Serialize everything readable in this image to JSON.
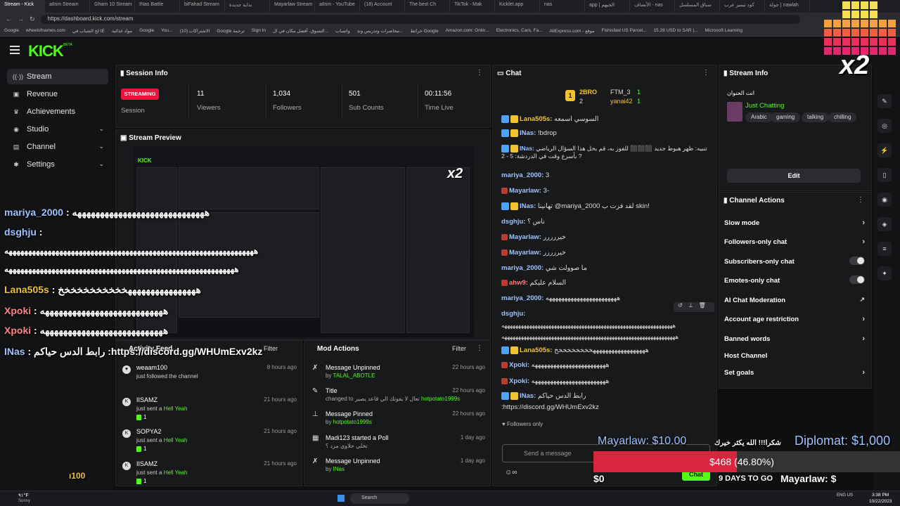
{
  "browser": {
    "tabs": [
      "Stream - Kick",
      "a8sm Stream",
      "Gharn 10 Stream",
      "INas Battle",
      "biFahad Stream",
      "بداية جديدة",
      "Mayarlaw Stream",
      "a8sm - YouTube",
      "(18) Account",
      "The best Ch",
      "TikTok - Mak",
      "Kicklet.app",
      "nas",
      "app | الجيهم",
      "الأنصاف - nas",
      "سباق المسلسل",
      "كود تيميز عرب",
      "جولة | nawlah"
    ],
    "url": "https://dashboard.kick.com/stream",
    "bookmarks": [
      "Google",
      "wheelofnames.com",
      "لج الشباب في IE",
      "مواد غذائية",
      "Google",
      "You...",
      "(10) الاشتراكات",
      "Google ترجمة",
      "Sign In",
      "التسوق، أفضل مكان في ال...",
      "واتساب",
      "محاضرات وتدريس وند...",
      "خرائط Google",
      "Amazon.com: Onlin...",
      "Electronics, Cars, Fa...",
      "AliExpress.com - موقع",
      "Fishisfast US Parcel...",
      "15.28 USD to SAR |...",
      "Microsoft Learning"
    ]
  },
  "header": {
    "logo": "KICK",
    "logo_sup": "BETA"
  },
  "sidebar": {
    "items": [
      {
        "label": "Stream",
        "icon": "stream-icon"
      },
      {
        "label": "Revenue",
        "icon": "revenue-icon"
      },
      {
        "label": "Achievements",
        "icon": "trophy-icon"
      },
      {
        "label": "Studio",
        "icon": "studio-icon"
      },
      {
        "label": "Channel",
        "icon": "channel-icon"
      },
      {
        "label": "Settings",
        "icon": "gear-icon"
      }
    ]
  },
  "session": {
    "title": "Session Info",
    "status": "STREAMING",
    "status_label": "Session",
    "stats": [
      {
        "value": "11",
        "label": "Viewers"
      },
      {
        "value": "1,034",
        "label": "Followers"
      },
      {
        "value": "501",
        "label": "Sub Counts"
      },
      {
        "value": "00:11:56",
        "label": "Time Live"
      }
    ]
  },
  "preview": {
    "title": "Stream Preview"
  },
  "overlay": {
    "lines": [
      {
        "user": "mariya_2000",
        "text": " : هههههههههههههههههههههههههههههه"
      },
      {
        "user": "dsghju",
        "text": " :"
      },
      {
        "user": "",
        "text": "ههههههههههههههههههههههههههههههههههههههههههههههههههههههههههههههههه"
      },
      {
        "user": "",
        "text": "هههههههههههههههههههههههههههههههههههههههههههههههههههههههههههه"
      },
      {
        "user": "Lana505s",
        "text": " : ههههههههههههههههخخخخخخخخخخخ"
      },
      {
        "user": "Xpoki",
        "text": " : هههههههههههههههههههههههههههه"
      },
      {
        "user": "Xpoki",
        "text": " : هههههههههههههههههههههههههههه"
      },
      {
        "user": "INas",
        "text": " : رابط الدس حياكم :https://discord.gg/WHUmExv2kz"
      }
    ],
    "x2": "x2",
    "donation_name": "Mayarlaw: $10.00",
    "thanks": "شكرا!!! الله يكثر خيرك",
    "diplomat": "Diplomat: $1,000",
    "goal_amount": "$468",
    "goal_pct": "(46.80%)",
    "goal_fill": 0.468,
    "zero": "$0",
    "days": "9 DAYS TO GO",
    "ticker": "Mayarlaw: $",
    "counter": "ı100"
  },
  "activity": {
    "title": "Activity Feed",
    "filter": "Filter",
    "items": [
      {
        "name": "weaam100",
        "sub": "just followed the channel",
        "gift": "",
        "time": "8 hours ago",
        "count": "",
        "icon": "heart-icon"
      },
      {
        "name": "IISAMZ",
        "sub": "just sent a ",
        "gift": "Hell Yeah",
        "time": "21 hours ago",
        "count": "1",
        "icon": "kick-gift-icon"
      },
      {
        "name": "SOPYA2",
        "sub": "just sent a ",
        "gift": "Hell Yeah",
        "time": "21 hours ago",
        "count": "1",
        "icon": "kick-gift-icon"
      },
      {
        "name": "IISAMZ",
        "sub": "just sent a ",
        "gift": "Hell Yeah",
        "time": "21 hours ago",
        "count": "1",
        "icon": "kick-gift-icon"
      }
    ]
  },
  "mod": {
    "title": "Mod Actions",
    "filter": "Filter",
    "items": [
      {
        "title": "Message Unpinned",
        "pre": "by ",
        "user": "TALAL_ABOTLE",
        "post": "",
        "time": "22 hours ago",
        "icon": "unpin-icon"
      },
      {
        "title": "Title",
        "pre": "changed to تعال لا يفوتك الي قاعد يصير ",
        "user": "hotpotato1999s",
        "post": "",
        "time": "22 hours ago",
        "icon": "edit-icon"
      },
      {
        "title": "Message Pinned",
        "pre": "by ",
        "user": "hotpotato1999s",
        "post": "",
        "time": "22 hours ago",
        "icon": "pin-icon"
      },
      {
        "title": "Madi123 started a Poll",
        "pre": "تخلي حلاوي مرد ؟",
        "user": "",
        "post": "",
        "time": "1 day ago",
        "icon": "poll-icon"
      },
      {
        "title": "Message Unpinned",
        "pre": "by ",
        "user": "INas",
        "post": "",
        "time": "1 day ago",
        "icon": "unpin-icon"
      }
    ]
  },
  "chat": {
    "title": "Chat",
    "top": {
      "user1": "2BRO",
      "count1": "2",
      "user2": "FTM_3",
      "count2": "1",
      "user3": "yanai42",
      "count3": "1"
    },
    "lines": [
      {
        "user": "Lana505s:",
        "text": " السوسي اسمعه",
        "color": "c-gold"
      },
      {
        "user": "INas:",
        "text": " !bdrop",
        "color": "c-blue"
      },
      {
        "user": "INas:",
        "text": " تنبيه: ظهر هبوط جديد ⬛⬛⬛ للفوز به، قم بحل هذا السؤال الرياضي بأسرع وقت في الدردشة: 5 - 2 ?",
        "color": "c-blue"
      },
      {
        "user": "mariya_2000:",
        "text": " 3",
        "color": "c-blue"
      },
      {
        "user": "Mayarlaw:",
        "text": " 3-",
        "color": "c-blue"
      },
      {
        "user": "INas:",
        "text": " تهانينا @mariya_2000 لقد فزت ب skin!",
        "color": "c-blue"
      },
      {
        "user": "dsghju:",
        "text": " ناس ؟",
        "color": "c-blue"
      },
      {
        "user": "Mayarlaw:",
        "text": " خيررررر",
        "color": "c-blue"
      },
      {
        "user": "Mayarlaw:",
        "text": " خيررررر",
        "color": "c-blue"
      },
      {
        "user": "mariya_2000:",
        "text": " ما صوولت شي",
        "color": "c-blue"
      },
      {
        "user": "ahw9:",
        "text": " السلام عليكم",
        "color": "c-red"
      },
      {
        "user": "mariya_2000:",
        "text": " هههههههههههههههههههههههه",
        "color": "c-blue"
      },
      {
        "user": "dsghju:",
        "text": "",
        "color": "c-blue"
      },
      {
        "user": "",
        "text": "ههههههههههههههههههههههههههههههههههههههههههههههههههههههههههههههه",
        "color": ""
      },
      {
        "user": "",
        "text": "هههههههههههههههههههههههههههههههههههههههههههههههههههههههههههههههه",
        "color": ""
      },
      {
        "user": "Lana505s:",
        "text": " ههههههههههههههههههخخخخخخخخخ",
        "color": "c-gold"
      },
      {
        "user": "Xpoki:",
        "text": " ههههههههههههههههههههههههه",
        "color": "c-blue"
      },
      {
        "user": "Xpoki:",
        "text": " ههههههههههههههههههههههههه",
        "color": "c-blue"
      },
      {
        "user": "INas:",
        "text": " رابط الدس حياكم",
        "color": "c-blue"
      },
      {
        "user": "",
        "text": ":https://discord.gg/WHUmExv2kz",
        "color": ""
      }
    ],
    "followers_only": "Followers only",
    "placeholder": "Send a message",
    "send": "Chat"
  },
  "stream_info": {
    "title": "Stream Info",
    "stream_title": "انت الحنوان",
    "category": "Just Chatting",
    "tags": [
      "Arabic",
      "gaming",
      "talking",
      "chilling"
    ],
    "edit": "Edit"
  },
  "channel_actions": {
    "title": "Channel Actions",
    "items": [
      {
        "label": "Slow mode",
        "control": "arrow"
      },
      {
        "label": "Followers-only chat",
        "control": "arrow"
      },
      {
        "label": "Subscribers-only chat",
        "control": "toggle"
      },
      {
        "label": "Emotes-only chat",
        "control": "toggle"
      },
      {
        "label": "AI Chat Moderation",
        "control": "external"
      },
      {
        "label": "Account age restriction",
        "control": "arrow"
      },
      {
        "label": "Banned words",
        "control": "arrow"
      },
      {
        "label": "Host Channel",
        "control": "none"
      },
      {
        "label": "Set goals",
        "control": "arrow"
      }
    ]
  },
  "taskbar": {
    "weather_temp": "٩١°F",
    "weather_text": "Sunny",
    "search": "Search",
    "lang": "ENG US",
    "time": "3:38 PM",
    "date": "10/22/2023"
  },
  "colors": {
    "accent": "#53fc18",
    "live": "#e4173d",
    "goal": "#d9253e"
  }
}
